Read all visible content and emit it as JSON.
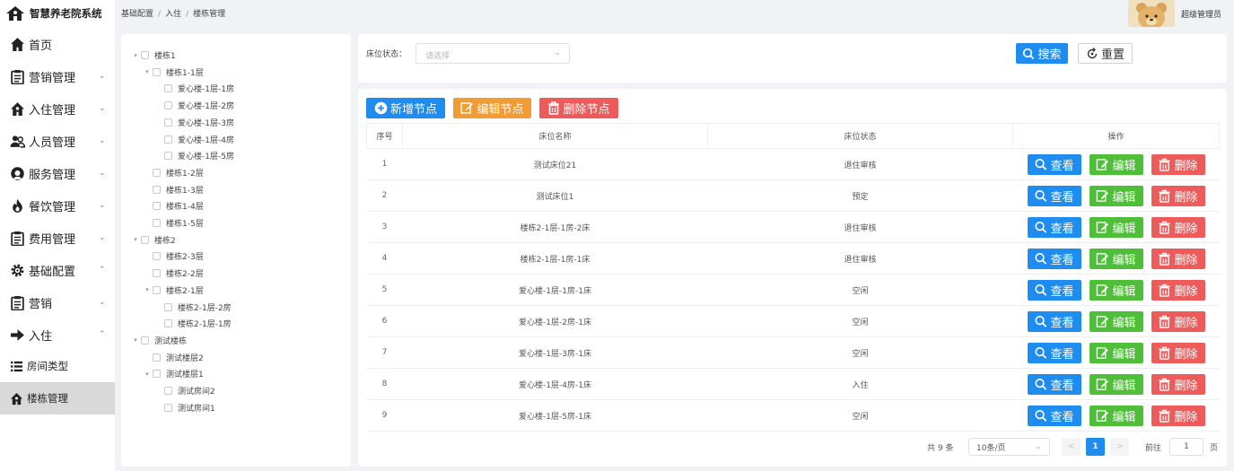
{
  "app": {
    "title": "智慧养老院系统"
  },
  "sidebar": {
    "items": [
      {
        "label": "首页",
        "icon": "home-icon",
        "expandable": false
      },
      {
        "label": "营销管理",
        "icon": "clipboard-icon",
        "expandable": true,
        "chevron": "⌄"
      },
      {
        "label": "入住管理",
        "icon": "house-icon",
        "expandable": true,
        "chevron": "⌄"
      },
      {
        "label": "人员管理",
        "icon": "people-icon",
        "expandable": true,
        "chevron": "⌄"
      },
      {
        "label": "服务管理",
        "icon": "headset-icon",
        "expandable": true,
        "chevron": "⌄"
      },
      {
        "label": "餐饮管理",
        "icon": "flame-icon",
        "expandable": true,
        "chevron": "⌄"
      },
      {
        "label": "费用管理",
        "icon": "clipboard-icon",
        "expandable": true,
        "chevron": "⌄"
      },
      {
        "label": "基础配置",
        "icon": "gear-icon",
        "expandable": true,
        "chevron": "⌃"
      },
      {
        "label": "营销",
        "icon": "clipboard-icon",
        "expandable": true,
        "chevron": "⌄"
      },
      {
        "label": "入住",
        "icon": "arrow-right-icon",
        "expandable": true,
        "chevron": "⌃"
      },
      {
        "label": "房间类型",
        "icon": "list-icon",
        "expandable": false
      },
      {
        "label": "楼栋管理",
        "icon": "house-icon",
        "expandable": false,
        "active": true
      }
    ]
  },
  "header": {
    "breadcrumb": [
      "基础配置",
      "入住",
      "楼栋管理"
    ],
    "separator": "/",
    "username": "超级管理员"
  },
  "tree": {
    "nodes": [
      {
        "label": "楼栋1",
        "level": 0,
        "expanded": true
      },
      {
        "label": "楼栋1-1层",
        "level": 1,
        "expanded": true
      },
      {
        "label": "爱心楼-1层-1房",
        "level": 2
      },
      {
        "label": "爱心楼-1层-2房",
        "level": 2
      },
      {
        "label": "爱心楼-1层-3房",
        "level": 2
      },
      {
        "label": "爱心楼-1层-4房",
        "level": 2
      },
      {
        "label": "爱心楼-1层-5房",
        "level": 2
      },
      {
        "label": "楼栋1-2层",
        "level": 1
      },
      {
        "label": "楼栋1-3层",
        "level": 1
      },
      {
        "label": "楼栋1-4层",
        "level": 1
      },
      {
        "label": "楼栋1-5层",
        "level": 1
      },
      {
        "label": "楼栋2",
        "level": 0,
        "expanded": true
      },
      {
        "label": "楼栋2-3层",
        "level": 1
      },
      {
        "label": "楼栋2-2层",
        "level": 1
      },
      {
        "label": "楼栋2-1层",
        "level": 1,
        "expanded": true
      },
      {
        "label": "楼栋2-1层-2房",
        "level": 2
      },
      {
        "label": "楼栋2-1层-1房",
        "level": 2
      },
      {
        "label": "测试楼栋",
        "level": 0,
        "expanded": true
      },
      {
        "label": "测试楼层2",
        "level": 1
      },
      {
        "label": "测试楼层1",
        "level": 1,
        "expanded": true
      },
      {
        "label": "测试房间2",
        "level": 2
      },
      {
        "label": "测试房间1",
        "level": 2
      }
    ]
  },
  "filter": {
    "label": "床位状态：",
    "placeholder": "请选择",
    "arrow": "⌄",
    "search_label": "搜索",
    "reset_label": "重置"
  },
  "actions": {
    "add_label": "新增节点",
    "edit_label": "编辑节点",
    "delete_label": "删除节点"
  },
  "table": {
    "headers": [
      "序号",
      "床位名称",
      "床位状态",
      "操作"
    ],
    "rows": [
      {
        "index": "1",
        "name": "测试床位21",
        "status": "退住审核"
      },
      {
        "index": "2",
        "name": "测试床位1",
        "status": "预定"
      },
      {
        "index": "3",
        "name": "楼栋2-1层-1房-2床",
        "status": "退住审核"
      },
      {
        "index": "4",
        "name": "楼栋2-1层-1房-1床",
        "status": "退住审核"
      },
      {
        "index": "5",
        "name": "爱心楼-1层-1房-1床",
        "status": "空闲"
      },
      {
        "index": "6",
        "name": "爱心楼-1层-2房-1床",
        "status": "空闲"
      },
      {
        "index": "7",
        "name": "爱心楼-1层-3房-1床",
        "status": "空闲"
      },
      {
        "index": "8",
        "name": "爱心楼-1层-4房-1床",
        "status": "入住"
      },
      {
        "index": "9",
        "name": "爱心楼-1层-5房-1床",
        "status": "空闲"
      }
    ],
    "row_actions": {
      "view": "查看",
      "edit": "编辑",
      "delete": "删除"
    }
  },
  "pagination": {
    "total_text": "共 9 条",
    "page_size": "10条/页",
    "page_size_arrow": "⌄",
    "prev": "<",
    "next": ">",
    "current": "1",
    "goto_label": "前往",
    "goto_value": "1",
    "page_suffix": "页"
  },
  "colors": {
    "primary": "#1f8cf0",
    "warning": "#f39c33",
    "danger": "#ee5b5b",
    "success": "#4fbf3a",
    "active_menu": "#d9d9d9"
  }
}
